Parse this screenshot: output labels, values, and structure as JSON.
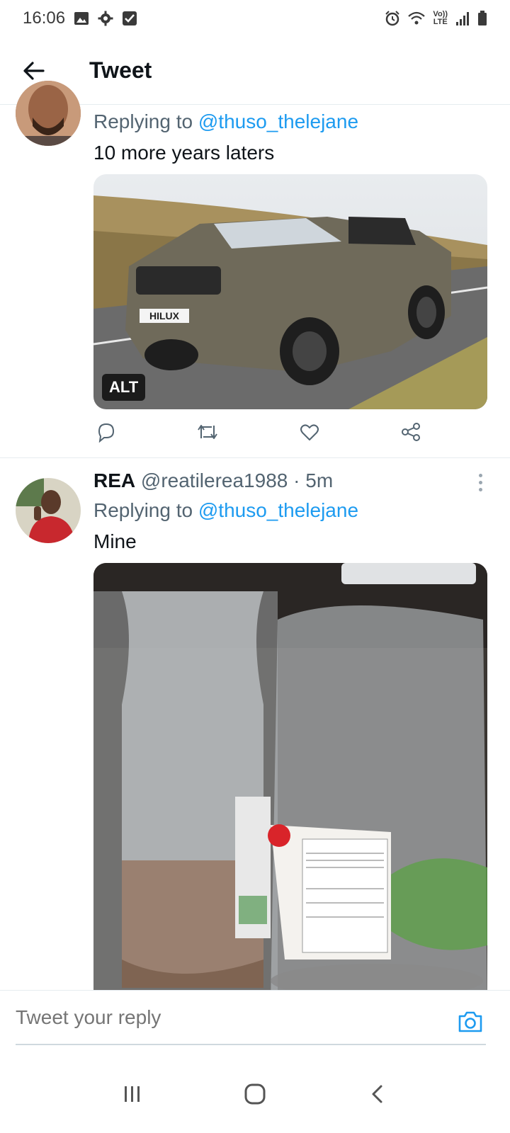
{
  "status_bar": {
    "time": "16:06",
    "icons_left": [
      "gallery-icon",
      "settings-icon",
      "checkbox-icon"
    ],
    "icons_right": [
      "alarm-icon",
      "wifi-icon",
      "volte-icon",
      "signal-icon",
      "battery-icon"
    ],
    "volte_label_top": "Vo))",
    "volte_label_bottom": "LTE"
  },
  "header": {
    "title": "Tweet",
    "back_icon": "arrow-left-icon"
  },
  "tweets": [
    {
      "replying_prefix": "Replying to ",
      "replying_to": "@thuso_thelejane",
      "text": "10 more years laters",
      "media_alt_badge": "ALT",
      "media_plate": "HILUX",
      "actions": [
        "reply-icon",
        "retweet-icon",
        "like-icon",
        "share-icon"
      ]
    },
    {
      "name": "REA",
      "handle": "@reatilerea1988",
      "separator": "·",
      "time": "5m",
      "replying_prefix": "Replying to ",
      "replying_to": "@thuso_thelejane",
      "text": "Mine"
    }
  ],
  "reply_bar": {
    "placeholder": "Tweet your reply",
    "camera_icon": "camera-icon"
  },
  "nav_bar": {
    "icons": [
      "recent-apps-icon",
      "home-icon",
      "back-icon"
    ]
  },
  "colors": {
    "accent": "#1d9bf0",
    "secondary_text": "#536471",
    "divider": "#e6ecf0"
  }
}
